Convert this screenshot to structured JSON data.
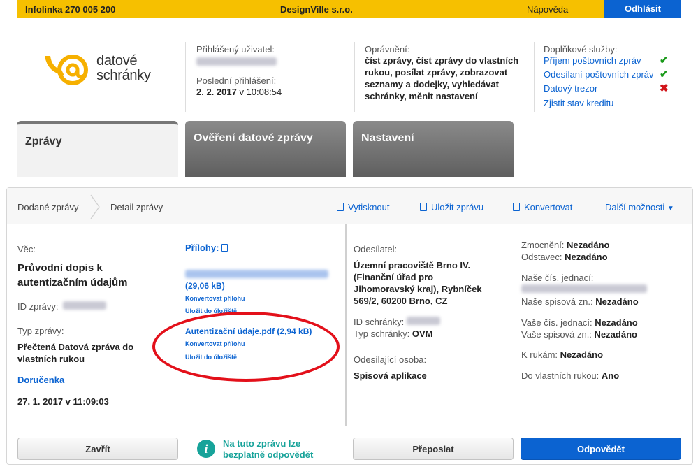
{
  "topbar": {
    "infoline": "Infolinka 270 005 200",
    "company": "DesignVille s.r.o.",
    "help": "Nápověda",
    "logout": "Odhlásit"
  },
  "logo": {
    "line1": "datové",
    "line2": "schránky"
  },
  "user": {
    "logged_label": "Přihlášený uživatel:",
    "last_login_label": "Poslední přihlášení:",
    "last_login_value": "2. 2. 2017",
    "last_login_time": "v 10:08:54"
  },
  "permissions": {
    "label": "Oprávnění:",
    "value": "číst zprávy, číst zprávy do vlastních rukou, posílat zprávy, zobrazovat seznamy a dodejky, vyhledávat schránky, měnit nastavení"
  },
  "services": {
    "label": "Doplňkové služby:",
    "items": [
      {
        "label": "Příjem poštovních zpráv",
        "status": "check"
      },
      {
        "label": "Odesílaní poštovních zpráv",
        "status": "check"
      },
      {
        "label": "Datový trezor",
        "status": "cross"
      },
      {
        "label": "Zjistit stav kreditu",
        "status": ""
      }
    ]
  },
  "tabs": [
    {
      "label": "Zprávy",
      "active": true
    },
    {
      "label": "Ověření datové zprávy",
      "active": false
    },
    {
      "label": "Nastavení",
      "active": false
    }
  ],
  "breadcrumb": {
    "item1": "Dodané zprávy",
    "item2": "Detail zprávy"
  },
  "actions": {
    "print": "Vytisknout",
    "save": "Uložit zprávu",
    "convert": "Konvertovat",
    "more": "Další možnosti"
  },
  "message": {
    "subject_label": "Věc:",
    "subject": "Průvodní dopis k autentizačním údajům",
    "id_label": "ID zprávy:",
    "type_label": "Typ zprávy:",
    "type_value": "Přečtená Datová zpráva do vlastních rukou",
    "receipt": "Doručenka",
    "date": "27. 1. 2017 v 11:09:03"
  },
  "attachments": {
    "label": "Přílohy:",
    "file1_size": "(29,06 kB)",
    "file1_convert": "Konvertovat přílohu",
    "file1_save": "Uložit do úložiště",
    "file2_name": "Autentizační údaje.pdf (2,94 kB)",
    "file2_convert": "Konvertovat přílohu",
    "file2_save": "Uložit do úložiště"
  },
  "sender": {
    "label": "Odesílatel:",
    "value": "Územní pracoviště Brno IV. (Finanční úřad pro Jihomoravský kraj), Rybníček 569/2, 60200 Brno, CZ",
    "box_id_label": "ID schránky:",
    "box_type_label": "Typ schránky:",
    "box_type_value": "OVM",
    "person_label": "Odesílající osoba:",
    "person_value": "Spisová aplikace"
  },
  "details": {
    "authorization_label": "Zmocnění:",
    "authorization_value": "Nezadáno",
    "paragraph_label": "Odstavec:",
    "paragraph_value": "Nezadáno",
    "our_ref_label": "Naše čís. jednací:",
    "our_file_label": "Naše spisová zn.:",
    "our_file_value": "Nezadáno",
    "your_ref_label": "Vaše čís. jednací:",
    "your_ref_value": "Nezadáno",
    "your_file_label": "Vaše spisová zn.:",
    "your_file_value": "Nezadáno",
    "attention_label": "K rukám:",
    "attention_value": "Nezadáno",
    "personal_label": "Do vlastních rukou:",
    "personal_value": "Ano"
  },
  "footer": {
    "close": "Zavřít",
    "info": "Na tuto zprávu lze bezplatně odpovědět",
    "forward": "Přeposlat",
    "reply": "Odpovědět"
  },
  "colors": {
    "accent": "#0b63d1",
    "brand_yellow": "#f6c000",
    "highlight": "#e3101a",
    "info": "#17a39a"
  }
}
